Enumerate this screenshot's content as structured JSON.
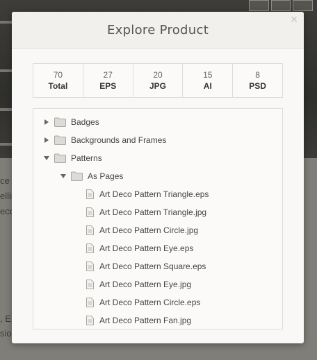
{
  "modal": {
    "title": "Explore Product",
    "close_label": "×"
  },
  "stats": [
    {
      "count": "70",
      "label": "Total"
    },
    {
      "count": "27",
      "label": "EPS"
    },
    {
      "count": "20",
      "label": "JPG"
    },
    {
      "count": "15",
      "label": "AI"
    },
    {
      "count": "8",
      "label": "PSD"
    }
  ],
  "tree": {
    "badges": "Badges",
    "backgrounds": "Backgrounds and Frames",
    "patterns": "Patterns",
    "as_pages": "As Pages",
    "files": [
      "Art Deco Pattern Triangle.eps",
      "Art Deco Pattern Triangle.jpg",
      "Art Deco Pattern Circle.jpg",
      "Art Deco Pattern Eye.eps",
      "Art Deco Pattern Square.eps",
      "Art Deco Pattern Eye.jpg",
      "Art Deco Pattern Circle.eps",
      "Art Deco Pattern Fan.jpg"
    ]
  },
  "background": {
    "fragments": [
      "ce",
      "ellin",
      "eco",
      ", E",
      "sio"
    ]
  }
}
